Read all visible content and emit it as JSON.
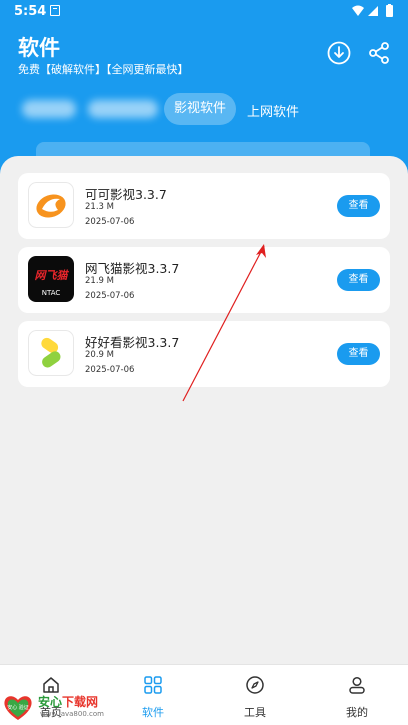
{
  "status_bar": {
    "time": "5:54"
  },
  "header": {
    "title": "软件",
    "subtitle": "免费【破解软件】【全网更新最快】"
  },
  "tabs": [
    {
      "label": "影视软件",
      "active": true
    },
    {
      "label": "上网软件",
      "active": false
    }
  ],
  "apps": [
    {
      "name": "可可影视3.3.7",
      "size": "21.3 M",
      "date": "2025-07-06",
      "button": "查看",
      "icon": "kekeyingshi-app-icon"
    },
    {
      "name": "网飞猫影视3.3.7",
      "size": "21.9 M",
      "date": "2025-07-06",
      "button": "查看",
      "icon": "wangfeimao-app-icon",
      "icon_text": "网飞猫",
      "icon_subtext": "NTAC"
    },
    {
      "name": "好好看影视3.3.7",
      "size": "20.9 M",
      "date": "2025-07-06",
      "button": "查看",
      "icon": "haohaokan-app-icon"
    }
  ],
  "bottom_nav": [
    {
      "label": "首页",
      "icon": "home-icon",
      "active": false
    },
    {
      "label": "软件",
      "icon": "grid-icon",
      "active": true
    },
    {
      "label": "工具",
      "icon": "compass-icon",
      "active": false
    },
    {
      "label": "我的",
      "icon": "user-icon",
      "active": false
    }
  ],
  "watermark": {
    "badge": "安心 验证",
    "title_main": "安心",
    "title_accent": "下载网",
    "url": "www.java800.com"
  },
  "colors": {
    "primary": "#1a9bef",
    "annotation_arrow": "#e02020"
  }
}
